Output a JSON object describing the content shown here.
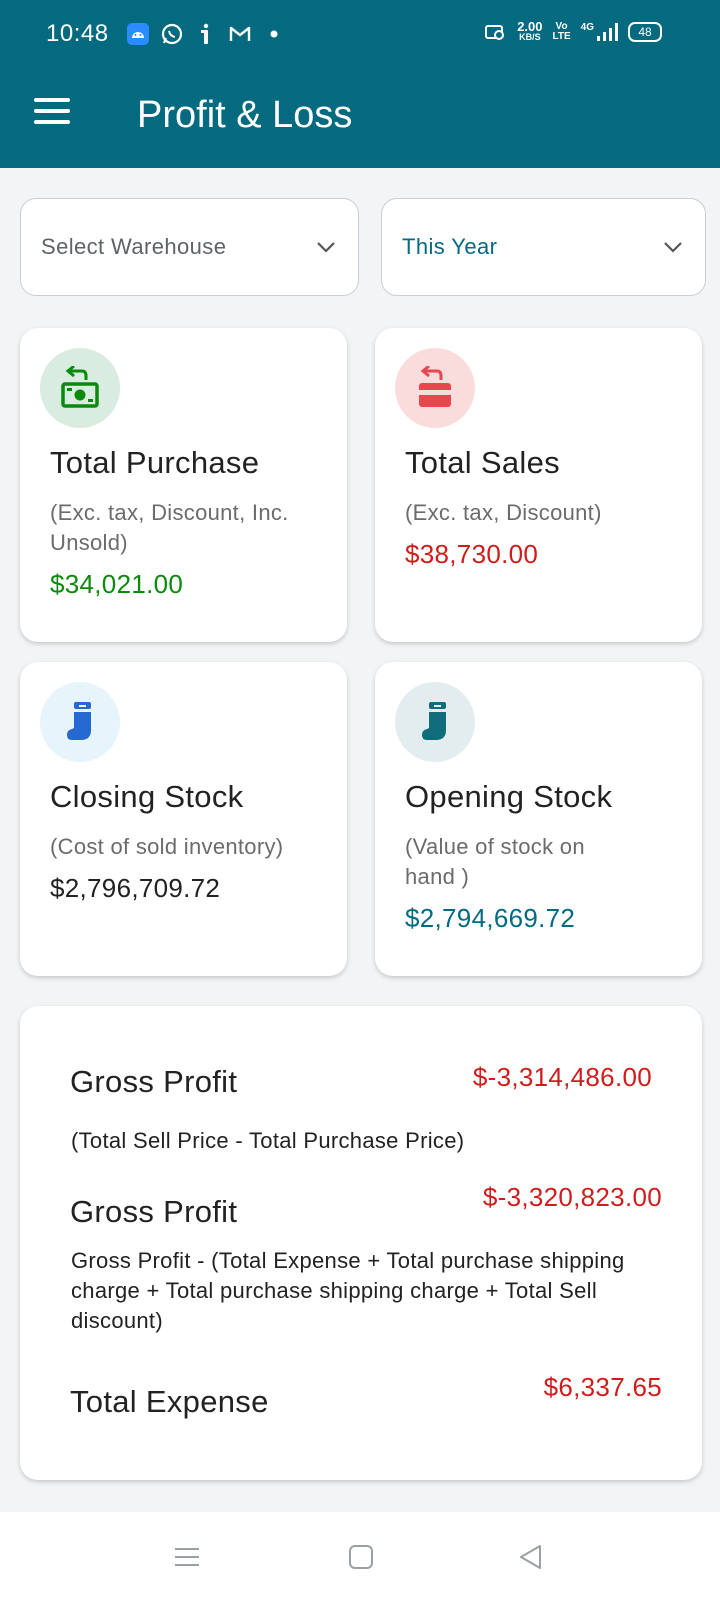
{
  "status_bar": {
    "time": "10:48",
    "left_icons": [
      "android-notification-icon",
      "whatsapp-icon",
      "info-icon",
      "gmail-icon",
      "dot-icon"
    ],
    "speed": "2.00",
    "speed_unit": "KB/S",
    "volte_top": "Vo",
    "volte_bottom": "LTE",
    "network": "4G",
    "battery": "48"
  },
  "app_bar": {
    "title": "Profit & Loss",
    "menu_icon": "hamburger-menu-icon"
  },
  "filters": {
    "warehouse": {
      "label": "Select Warehouse"
    },
    "period": {
      "label": "This Year"
    }
  },
  "cards": {
    "total_purchase": {
      "title": "Total Purchase",
      "subtitle": "(Exc. tax, Discount, Inc. Unsold)",
      "value": "$34,021.00",
      "color": "#0a8a0a",
      "icon": "money-return-icon"
    },
    "total_sales": {
      "title": "Total Sales",
      "subtitle": "(Exc. tax, Discount)",
      "value": "$38,730.00",
      "color": "#d01c1c",
      "icon": "card-return-icon"
    },
    "closing_stock": {
      "title": "Closing Stock",
      "subtitle": "(Cost of sold inventory)",
      "value": "$2,796,709.72",
      "color": "#222222",
      "icon": "stocking-icon"
    },
    "opening_stock": {
      "title": "Opening Stock",
      "subtitle": "(Value of stock on hand )",
      "value": "$2,794,669.72",
      "color": "#046a80",
      "icon": "stocking-icon"
    }
  },
  "summary": {
    "gross_profit_1": {
      "title": "Gross Profit",
      "value": "$-3,314,486.00",
      "description": "(Total Sell Price - Total Purchase Price)"
    },
    "gross_profit_2": {
      "title": "Gross Profit",
      "value": "$-3,320,823.00",
      "description": "Gross Profit - (Total Expense + Total purchase shipping charge + Total purchase shipping charge + Total Sell discount)"
    },
    "total_expense": {
      "title": "Total Expense",
      "value": "$6,337.65"
    }
  },
  "nav_bar": {
    "buttons": [
      "recents-icon",
      "home-icon",
      "back-icon"
    ]
  }
}
